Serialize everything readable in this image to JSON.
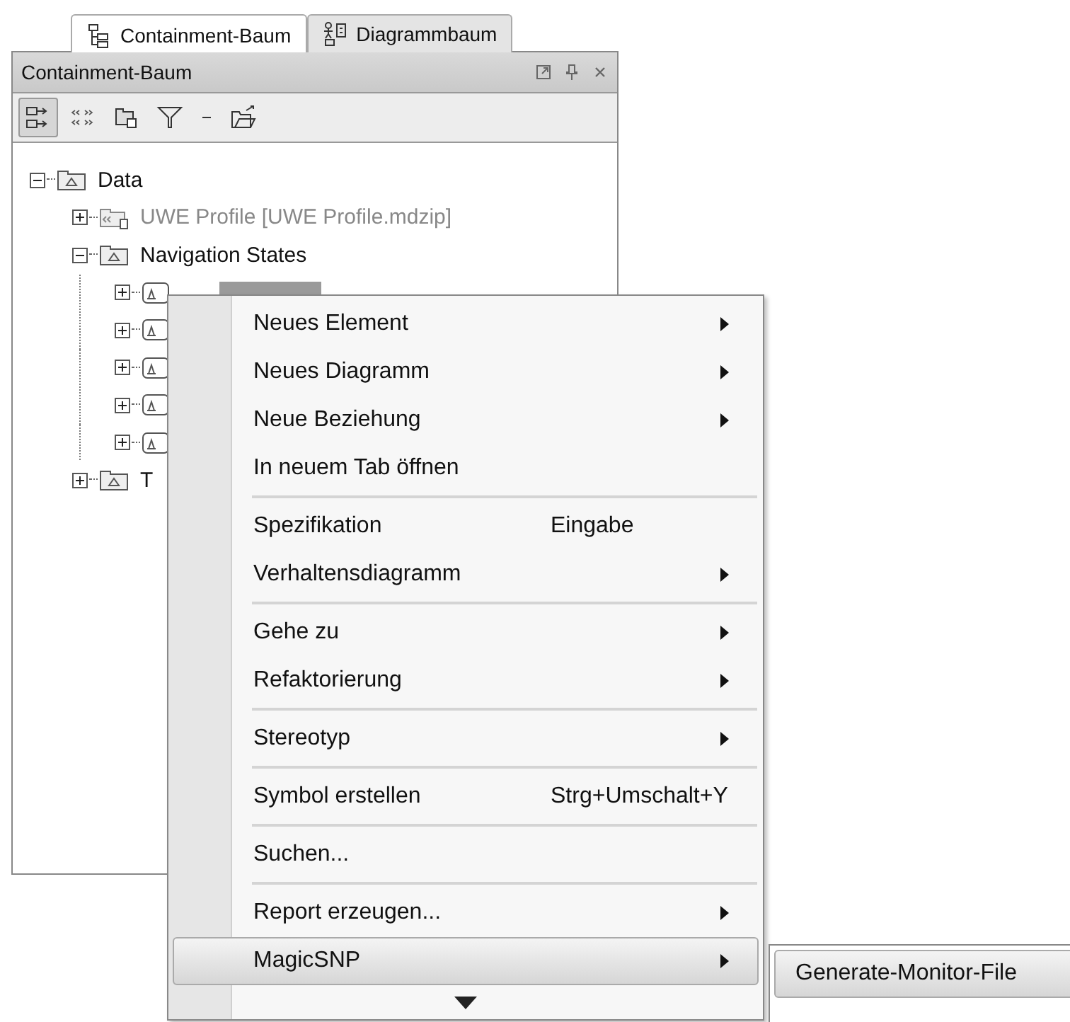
{
  "tabs": [
    {
      "label": "Containment-Baum",
      "selected": true,
      "kind": "tree"
    },
    {
      "label": "Diagrammbaum",
      "selected": false,
      "kind": "diagram"
    }
  ],
  "panel": {
    "title": "Containment-Baum",
    "toolbar": [
      {
        "kind": "expand",
        "selected": true
      },
      {
        "kind": "stereotype",
        "selected": false
      },
      {
        "kind": "package",
        "selected": false
      },
      {
        "kind": "filter",
        "selected": false
      },
      {
        "kind": "dash",
        "selected": false
      },
      {
        "kind": "open",
        "selected": false
      }
    ]
  },
  "tree": [
    {
      "label": "Data",
      "kind": "package",
      "expanded": true,
      "selected": false,
      "disabled": false,
      "children": [
        {
          "label": "UWE Profile [UWE Profile.mdzip]",
          "kind": "profile",
          "expanded": false,
          "selected": false,
          "disabled": true
        },
        {
          "label": "Navigation States",
          "kind": "package",
          "expanded": true,
          "selected": false,
          "disabled": false,
          "children": [
            {
              "kind": "state",
              "expanded": false,
              "selected": true
            },
            {
              "kind": "state",
              "expanded": false
            },
            {
              "kind": "state",
              "expanded": false
            },
            {
              "kind": "state",
              "expanded": false
            },
            {
              "kind": "state",
              "expanded": false
            }
          ]
        },
        {
          "label": "T",
          "kind": "package",
          "expanded": false,
          "selected": false,
          "disabled": false
        }
      ]
    }
  ],
  "context_menu": {
    "items": [
      {
        "kind": "item",
        "label": "Neues Element",
        "submenu": true,
        "selected": false
      },
      {
        "kind": "item",
        "label": "Neues Diagramm",
        "submenu": true,
        "selected": false
      },
      {
        "kind": "item",
        "label": "Neue Beziehung",
        "submenu": true,
        "selected": false
      },
      {
        "kind": "item",
        "label": "In neuem Tab öffnen",
        "submenu": false,
        "selected": false
      },
      {
        "kind": "separator"
      },
      {
        "kind": "item",
        "label": "Spezifikation",
        "shortcut": "Eingabe",
        "submenu": false,
        "selected": false
      },
      {
        "kind": "item",
        "label": "Verhaltensdiagramm",
        "submenu": true,
        "selected": false
      },
      {
        "kind": "separator"
      },
      {
        "kind": "item",
        "label": "Gehe zu",
        "submenu": true,
        "selected": false
      },
      {
        "kind": "item",
        "label": "Refaktorierung",
        "submenu": true,
        "selected": false
      },
      {
        "kind": "separator"
      },
      {
        "kind": "item",
        "label": "Stereotyp",
        "submenu": true,
        "selected": false
      },
      {
        "kind": "separator"
      },
      {
        "kind": "item",
        "label": "Symbol erstellen",
        "shortcut": "Strg+Umschalt+Y",
        "submenu": false,
        "selected": false
      },
      {
        "kind": "separator"
      },
      {
        "kind": "item",
        "label": "Suchen...",
        "submenu": false,
        "selected": false
      },
      {
        "kind": "separator"
      },
      {
        "kind": "item",
        "label": "Report erzeugen...",
        "submenu": true,
        "selected": false
      },
      {
        "kind": "item",
        "label": "MagicSNP",
        "submenu": true,
        "selected": true
      }
    ],
    "scroll_down": true
  },
  "submenu": {
    "items": [
      {
        "label": "Generate-Monitor-File",
        "selected": true
      }
    ]
  }
}
